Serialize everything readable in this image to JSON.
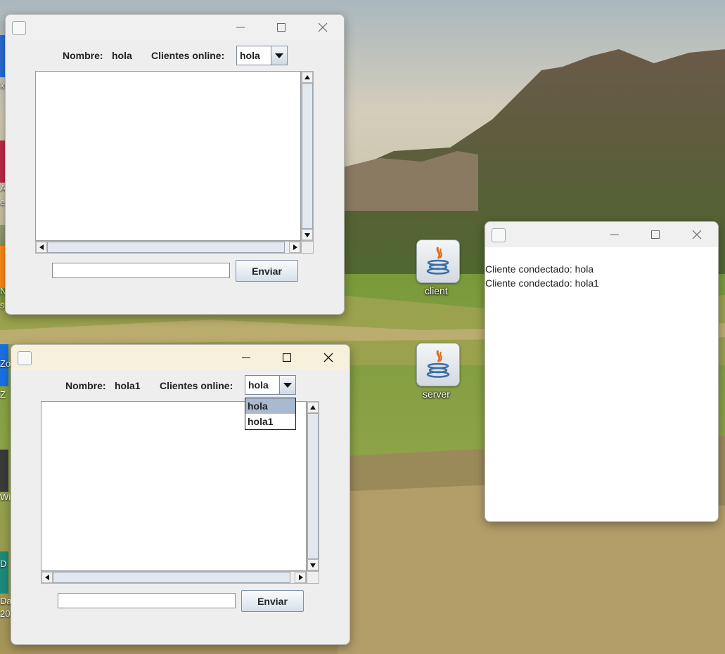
{
  "desktop": {
    "icons": [
      {
        "label": "client",
        "icon": "java-icon"
      },
      {
        "label": "server",
        "icon": "java-icon"
      }
    ],
    "edge_fragments": [
      "ke",
      "A",
      "e",
      "N",
      "s",
      "Zo",
      "Z",
      "Wi",
      "D",
      "Dat",
      "20"
    ]
  },
  "client_window_1": {
    "name_label": "Nombre:",
    "name_value": "hola",
    "online_label": "Clientes online:",
    "combo_selected": "hola",
    "message_input": "",
    "send_label": "Enviar"
  },
  "client_window_2": {
    "name_label": "Nombre:",
    "name_value": "hola1",
    "online_label": "Clientes online:",
    "combo_selected": "hola",
    "dropdown_options": [
      "hola",
      "hola1"
    ],
    "message_input": "",
    "send_label": "Enviar"
  },
  "server_window": {
    "log": [
      "Cliente condectado: hola",
      "Cliente condectado: hola1"
    ]
  },
  "colors": {
    "titlebar_active": "#f7f0dc",
    "dropdown_selected": "#a9bad0",
    "window_bg": "#eeeeee"
  }
}
